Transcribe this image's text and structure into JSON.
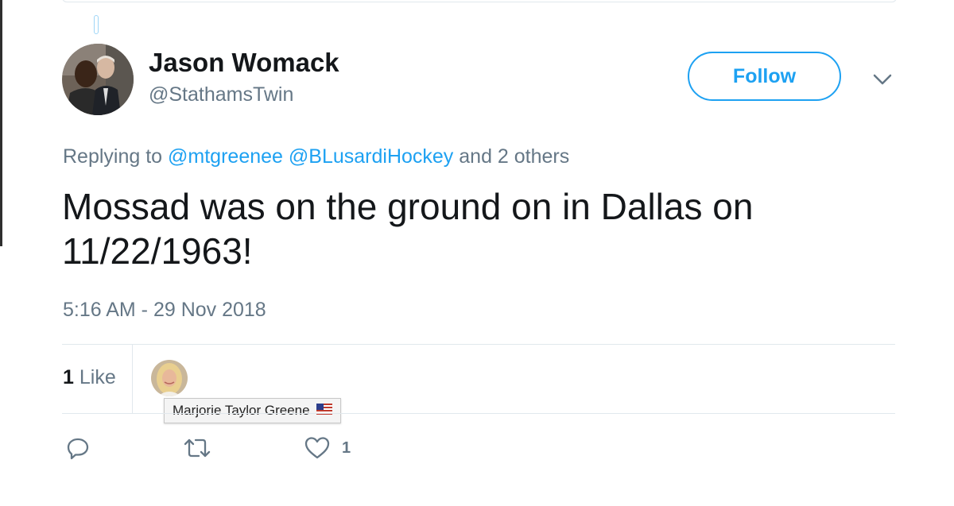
{
  "user": {
    "display_name": "Jason Womack",
    "handle": "@StathamsTwin"
  },
  "follow_label": "Follow",
  "reply_context": {
    "prefix": "Replying to",
    "mentions": [
      "@mtgreenee",
      "@BLusardiHockey"
    ],
    "suffix": "and 2 others"
  },
  "tweet": {
    "text": "Mossad was on the ground on in Dallas on 11/22/1963!",
    "timestamp": "5:16 AM - 29 Nov 2018"
  },
  "stats": {
    "like_count": "1",
    "like_label": "Like"
  },
  "tooltip": {
    "name": "Marjorie Taylor Greene"
  },
  "actions": {
    "reply_icon": "reply-icon",
    "retweet_icon": "retweet-icon",
    "like_icon": "heart-icon",
    "like_count": "1"
  },
  "colors": {
    "accent": "#1da1f2",
    "text": "#14171a",
    "secondary": "#657786",
    "border": "#e1e8ed"
  }
}
